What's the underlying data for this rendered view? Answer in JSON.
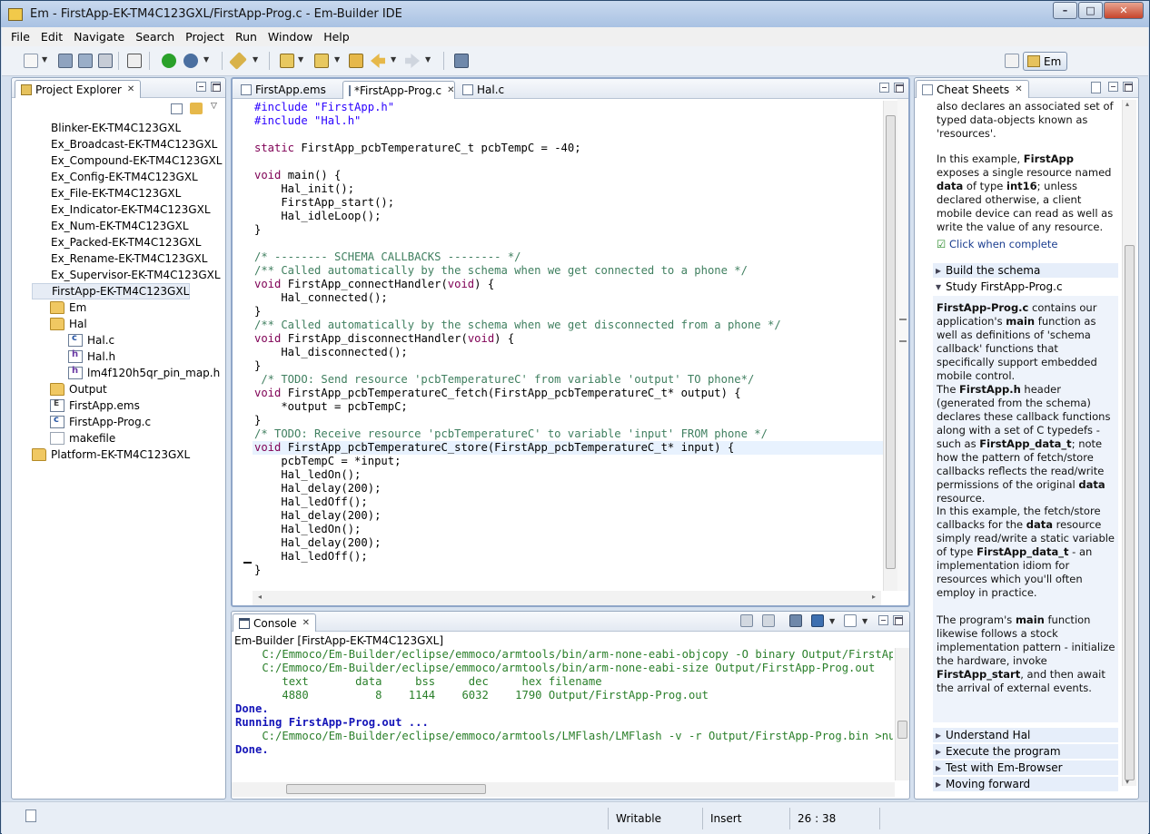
{
  "window": {
    "title": "Em - FirstApp-EK-TM4C123GXL/FirstApp-Prog.c - Em-Builder IDE",
    "min": "–",
    "max": "□",
    "close": "✕"
  },
  "menu": [
    "File",
    "Edit",
    "Navigate",
    "Search",
    "Project",
    "Run",
    "Window",
    "Help"
  ],
  "perspective": {
    "label": "Em"
  },
  "explorer": {
    "title": "Project Explorer",
    "items": [
      {
        "label": "Blinker-EK-TM4C123GXL",
        "type": "project",
        "indent": 0
      },
      {
        "label": "Ex_Broadcast-EK-TM4C123GXL",
        "type": "project",
        "indent": 0
      },
      {
        "label": "Ex_Compound-EK-TM4C123GXL",
        "type": "project",
        "indent": 0
      },
      {
        "label": "Ex_Config-EK-TM4C123GXL",
        "type": "project",
        "indent": 0
      },
      {
        "label": "Ex_File-EK-TM4C123GXL",
        "type": "project",
        "indent": 0
      },
      {
        "label": "Ex_Indicator-EK-TM4C123GXL",
        "type": "project",
        "indent": 0
      },
      {
        "label": "Ex_Num-EK-TM4C123GXL",
        "type": "project",
        "indent": 0
      },
      {
        "label": "Ex_Packed-EK-TM4C123GXL",
        "type": "project",
        "indent": 0
      },
      {
        "label": "Ex_Rename-EK-TM4C123GXL",
        "type": "project",
        "indent": 0
      },
      {
        "label": "Ex_Supervisor-EK-TM4C123GXL",
        "type": "project",
        "indent": 0
      },
      {
        "label": "FirstApp-EK-TM4C123GXL",
        "type": "project",
        "indent": 0,
        "selected": true
      },
      {
        "label": "Em",
        "type": "folder",
        "indent": 1
      },
      {
        "label": "Hal",
        "type": "folder",
        "indent": 1
      },
      {
        "label": "Hal.c",
        "type": "cfile",
        "indent": 2
      },
      {
        "label": "Hal.h",
        "type": "hfile",
        "indent": 2
      },
      {
        "label": "lm4f120h5qr_pin_map.h",
        "type": "hfile",
        "indent": 2
      },
      {
        "label": "Output",
        "type": "folder",
        "indent": 1
      },
      {
        "label": "FirstApp.ems",
        "type": "efile",
        "indent": 1
      },
      {
        "label": "FirstApp-Prog.c",
        "type": "cfile",
        "indent": 1
      },
      {
        "label": "makefile",
        "type": "mfile",
        "indent": 1
      },
      {
        "label": "Platform-EK-TM4C123GXL",
        "type": "folder",
        "indent": 0
      }
    ]
  },
  "editor": {
    "tabs": [
      {
        "label": "FirstApp.ems",
        "active": false
      },
      {
        "label": "*FirstApp-Prog.c",
        "active": true
      },
      {
        "label": "Hal.c",
        "active": false
      }
    ],
    "lines": [
      [
        [
          "str",
          "#include \"FirstApp.h\""
        ]
      ],
      [
        [
          "str",
          "#include \"Hal.h\""
        ]
      ],
      [],
      [
        [
          "kw",
          "static"
        ],
        [
          "t",
          " FirstApp_pcbTemperatureC_t pcbTempC = -40;"
        ]
      ],
      [],
      [
        [
          "kw",
          "void"
        ],
        [
          "t",
          " main() {"
        ]
      ],
      [
        [
          "t",
          "    Hal_init();"
        ]
      ],
      [
        [
          "t",
          "    FirstApp_start();"
        ]
      ],
      [
        [
          "t",
          "    Hal_idleLoop();"
        ]
      ],
      [
        [
          "t",
          "}"
        ]
      ],
      [],
      [
        [
          "cm",
          "/* -------- SCHEMA CALLBACKS -------- */"
        ]
      ],
      [
        [
          "cm",
          "/** Called automatically by the schema when we get connected to a phone */"
        ]
      ],
      [
        [
          "kw",
          "void"
        ],
        [
          "t",
          " FirstApp_connectHandler("
        ],
        [
          "kw",
          "void"
        ],
        [
          "t",
          ") {"
        ]
      ],
      [
        [
          "t",
          "    Hal_connected();"
        ]
      ],
      [
        [
          "t",
          "}"
        ]
      ],
      [
        [
          "cm",
          "/** Called automatically by the schema when we get disconnected from a phone */"
        ]
      ],
      [
        [
          "kw",
          "void"
        ],
        [
          "t",
          " FirstApp_disconnectHandler("
        ],
        [
          "kw",
          "void"
        ],
        [
          "t",
          ") {"
        ]
      ],
      [
        [
          "t",
          "    Hal_disconnected();"
        ]
      ],
      [
        [
          "t",
          "}"
        ]
      ],
      [
        [
          "cm",
          " /* TODO: Send resource 'pcbTemperatureC' from variable 'output' TO phone*/"
        ]
      ],
      [
        [
          "kw",
          "void"
        ],
        [
          "t",
          " FirstApp_pcbTemperatureC_fetch(FirstApp_pcbTemperatureC_t* output) {"
        ]
      ],
      [
        [
          "t",
          "    *output = pcbTempC;"
        ]
      ],
      [
        [
          "t",
          "}"
        ]
      ],
      [
        [
          "cm",
          "/* TODO: Receive resource 'pcbTemperatureC' to variable 'input' FROM phone */"
        ]
      ],
      [
        [
          "kw",
          "void"
        ],
        [
          "t",
          " FirstApp_pcbTemperatureC_store(FirstApp_pcbTemperatureC_t* input) {"
        ]
      ],
      [
        [
          "t",
          "    pcbTempC = *input;"
        ]
      ],
      [
        [
          "t",
          "    Hal_ledOn();"
        ]
      ],
      [
        [
          "t",
          "    Hal_delay(200);"
        ]
      ],
      [
        [
          "t",
          "    Hal_ledOff();"
        ]
      ],
      [
        [
          "t",
          "    Hal_delay(200);"
        ]
      ],
      [
        [
          "t",
          "    Hal_ledOn();"
        ]
      ],
      [
        [
          "t",
          "    Hal_delay(200);"
        ]
      ],
      [
        [
          "t",
          "    Hal_ledOff();"
        ]
      ],
      [
        [
          "t",
          "}"
        ]
      ]
    ],
    "current_line": 26
  },
  "console": {
    "title": "Console",
    "subtitle": "Em-Builder [FirstApp-EK-TM4C123GXL]",
    "lines": [
      {
        "style": "g",
        "text": "    C:/Emmoco/Em-Builder/eclipse/emmoco/armtools/bin/arm-none-eabi-objcopy -O binary Output/FirstApp-Prog.bin"
      },
      {
        "style": "g",
        "text": "    C:/Emmoco/Em-Builder/eclipse/emmoco/armtools/bin/arm-none-eabi-size Output/FirstApp-Prog.out"
      },
      {
        "style": "g",
        "text": "       text       data     bss     dec     hex filename"
      },
      {
        "style": "g",
        "text": "       4880          8    1144    6032    1790 Output/FirstApp-Prog.out"
      },
      {
        "style": "b",
        "text": "Done."
      },
      {
        "style": "b",
        "text": "Running FirstApp-Prog.out ..."
      },
      {
        "style": "g",
        "text": "    C:/Emmoco/Em-Builder/eclipse/emmoco/armtools/LMFlash/LMFlash -v -r Output/FirstApp-Prog.bin >nul"
      },
      {
        "style": "b",
        "text": "Done."
      }
    ]
  },
  "cheat": {
    "title": "Cheat Sheets",
    "intro": [
      "also declares an associated set of",
      "typed data-objects known as",
      "'resources'."
    ],
    "para1": [
      [
        "t",
        "In this example, "
      ],
      [
        "b",
        "FirstApp"
      ],
      [
        "t",
        " exposes a single resource named "
      ],
      [
        "b",
        "data"
      ],
      [
        "t",
        " of type "
      ],
      [
        "b",
        "int16"
      ],
      [
        "t",
        "; unless declared otherwise, a client mobile device can read as well as write the value of any resource."
      ]
    ],
    "click_complete": "Click when complete",
    "sections": [
      {
        "label": "Build the schema",
        "open": false
      },
      {
        "label": "Study FirstApp-Prog.c",
        "open": true
      },
      {
        "label": "Understand Hal",
        "open": false
      },
      {
        "label": "Execute the program",
        "open": false
      },
      {
        "label": "Test with Em-Browser",
        "open": false
      },
      {
        "label": "Moving forward",
        "open": false
      }
    ],
    "study": [
      [
        [
          "b",
          "FirstApp-Prog.c"
        ],
        [
          "t",
          " contains our application's "
        ],
        [
          "b",
          "main"
        ],
        [
          "t",
          " function as well as definitions of 'schema callback' functions that specifically support embedded mobile control."
        ]
      ],
      [
        [
          "t",
          "The "
        ],
        [
          "b",
          "FirstApp.h"
        ],
        [
          "t",
          " header (generated from the schema) declares these callback functions along with a set of C typedefs - such as "
        ],
        [
          "b",
          "FirstApp_data_t"
        ],
        [
          "t",
          "; note how the pattern of fetch/store callbacks reflects the read/write permissions of the original "
        ],
        [
          "b",
          "data"
        ],
        [
          "t",
          " resource."
        ]
      ],
      [
        [
          "t",
          "In this example, the fetch/store callbacks for the "
        ],
        [
          "b",
          "data"
        ],
        [
          "t",
          " resource simply read/write a static variable of type "
        ],
        [
          "b",
          "FirstApp_data_t"
        ],
        [
          "t",
          " - an implementation idiom for resources which you'll often employ in practice."
        ]
      ],
      [
        [
          "t",
          "The program's "
        ],
        [
          "b",
          "main"
        ],
        [
          "t",
          " function likewise follows a stock implementation pattern - initialize the hardware, invoke "
        ],
        [
          "b",
          "FirstApp_start"
        ],
        [
          "t",
          ", and then await the arrival of external events."
        ]
      ]
    ]
  },
  "status": {
    "writable": "Writable",
    "insert": "Insert",
    "position": "26 : 38"
  },
  "colors": {
    "keyword": "#7f0055",
    "string": "#2a00ff",
    "comment": "#3f7f5f",
    "console_green": "#2a7f2a",
    "console_blue": "#1414b8"
  }
}
